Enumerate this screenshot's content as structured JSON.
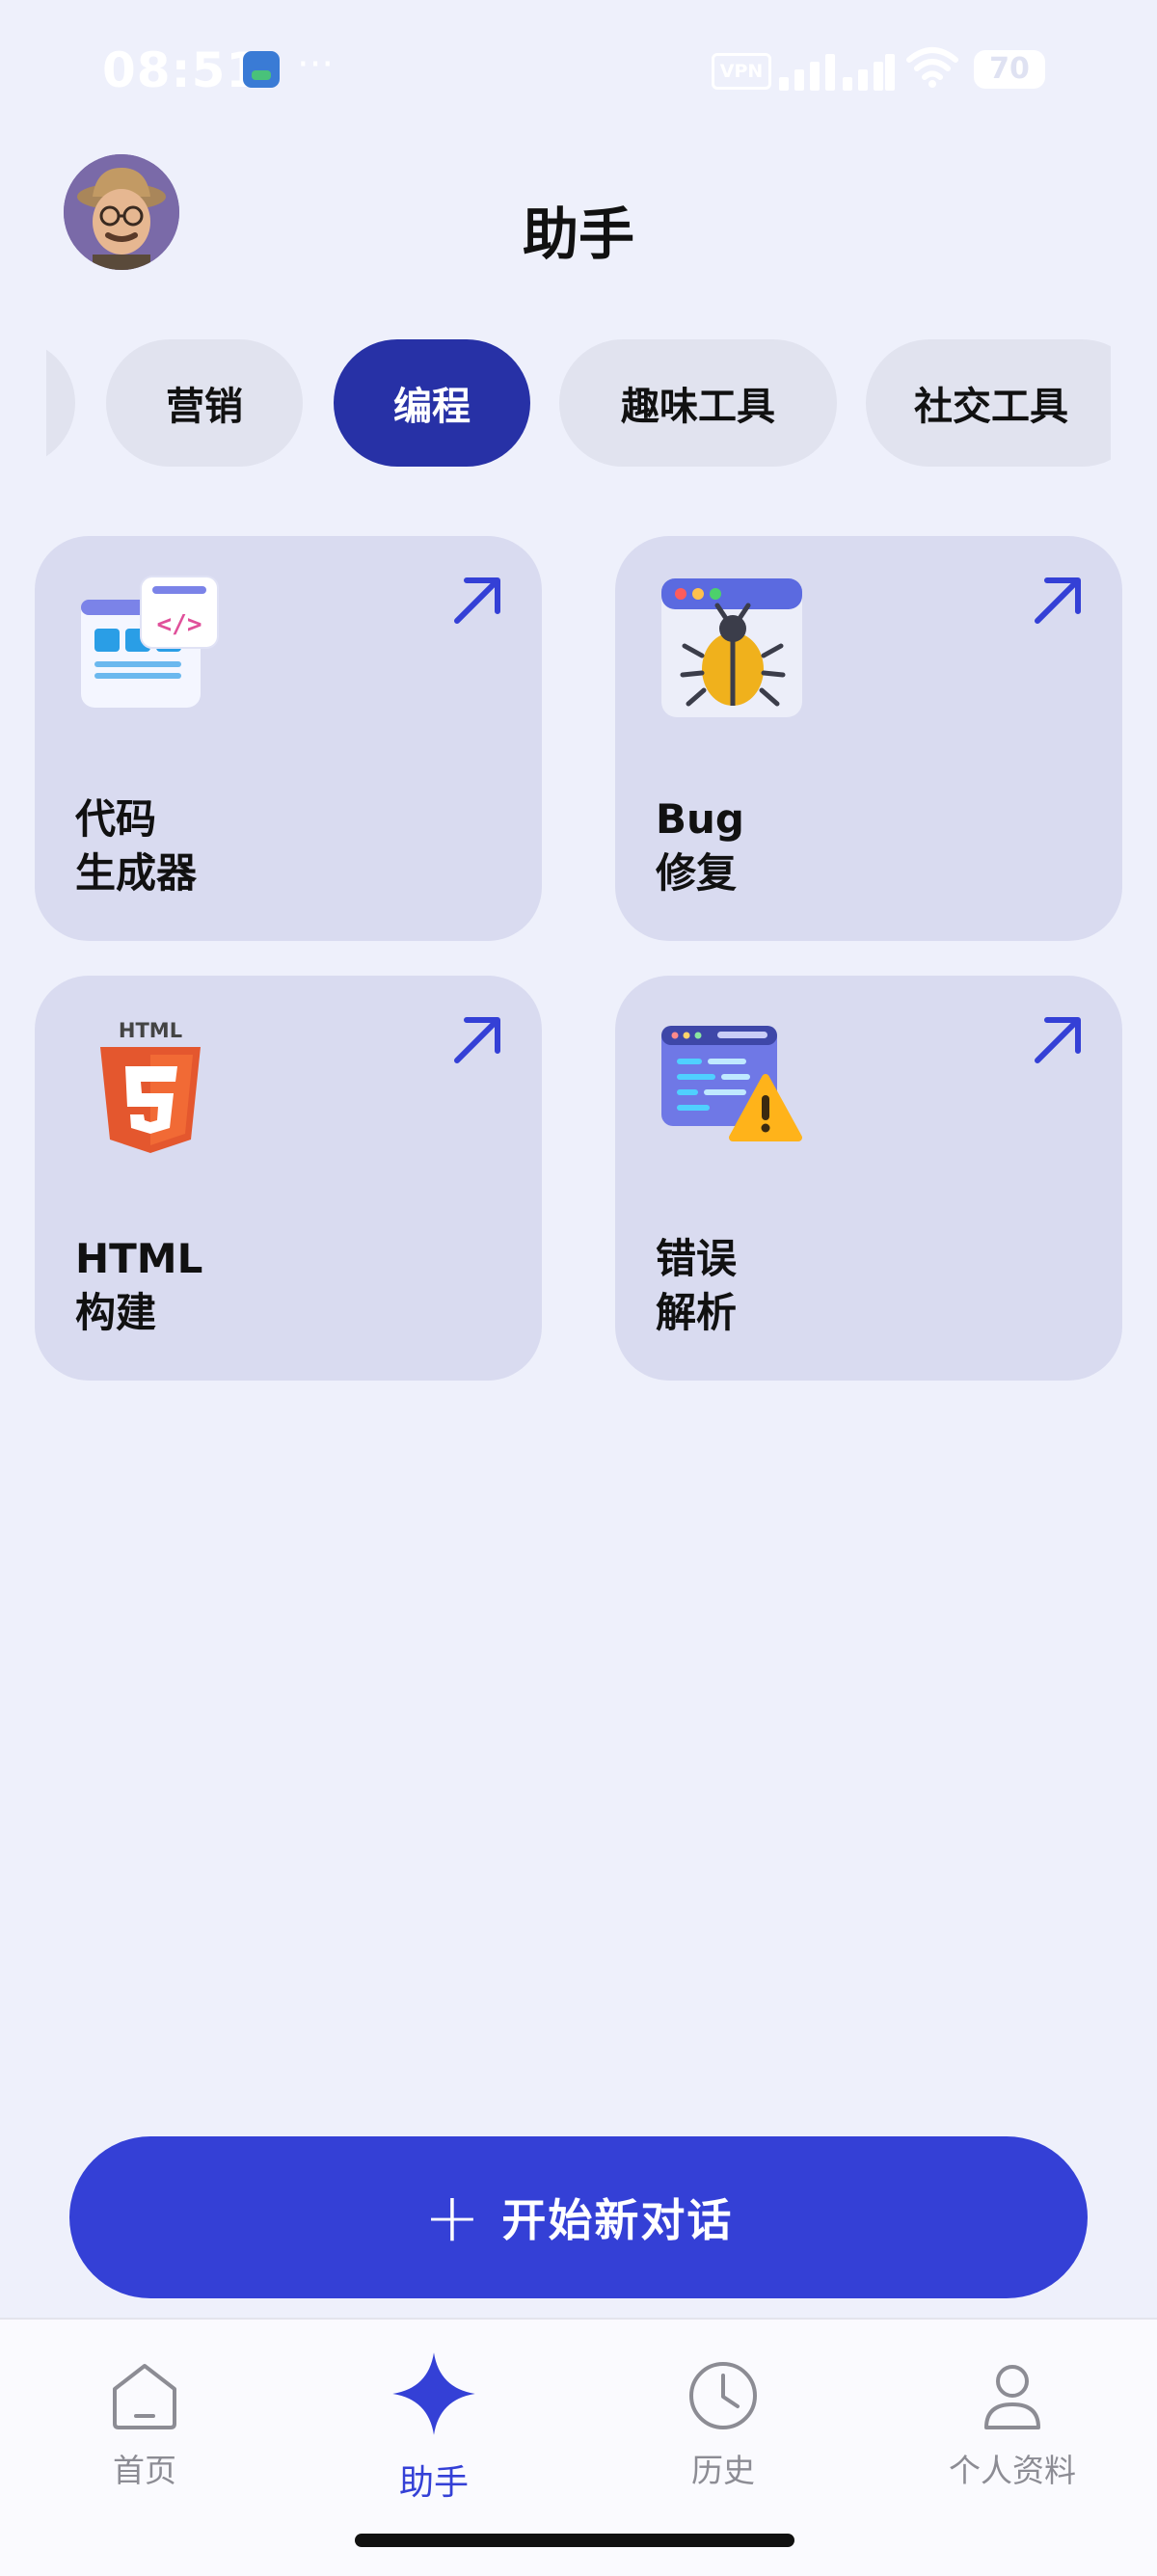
{
  "status_bar": {
    "time": "08:51",
    "dots": "···",
    "vpn": "VPN",
    "battery": "70"
  },
  "header": {
    "title": "助手"
  },
  "tabs": [
    {
      "label": ""
    },
    {
      "label": "营销"
    },
    {
      "label": "编程",
      "active": true
    },
    {
      "label": "趣味工具"
    },
    {
      "label": "社交工具"
    }
  ],
  "cards": [
    {
      "line1": "代码",
      "line2": "生成器",
      "icon": "code-window-icon"
    },
    {
      "line1": "Bug",
      "line2": "修复",
      "icon": "bug-icon"
    },
    {
      "line1": "HTML",
      "line2": "构建",
      "icon": "html5-icon",
      "icon_text": "HTML"
    },
    {
      "line1": "错误",
      "line2": "解析",
      "icon": "warning-code-icon"
    }
  ],
  "cta": {
    "plus": "+",
    "label": "开始新对话"
  },
  "nav": [
    {
      "label": "首页",
      "icon": "home-icon"
    },
    {
      "label": "助手",
      "icon": "sparkle-icon",
      "active": true
    },
    {
      "label": "历史",
      "icon": "clock-icon"
    },
    {
      "label": "个人资料",
      "icon": "person-icon"
    }
  ],
  "colors": {
    "accent": "#3440d6",
    "active_tab": "#2731a6",
    "card_bg": "#d9dbf0",
    "page_bg": "#eef0fb"
  }
}
